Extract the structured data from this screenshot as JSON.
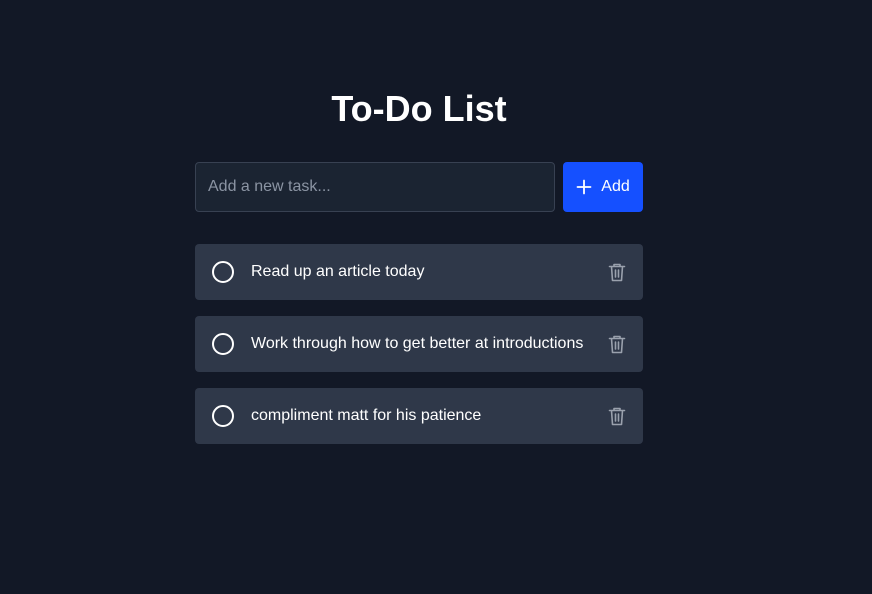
{
  "header": {
    "title": "To-Do List"
  },
  "add_form": {
    "placeholder": "Add a new task...",
    "value": "",
    "button_label": "Add",
    "button_icon": "plus-icon"
  },
  "tasks": [
    {
      "text": "Read up an article today",
      "completed": false
    },
    {
      "text": "Work through how to get better at introductions",
      "completed": false
    },
    {
      "text": "compliment matt for his patience",
      "completed": false
    }
  ],
  "colors": {
    "background": "#121826",
    "card": "#2f3849",
    "input_background": "#1b2432",
    "accent": "#1550ff",
    "muted_icon": "#9aa1ad"
  }
}
